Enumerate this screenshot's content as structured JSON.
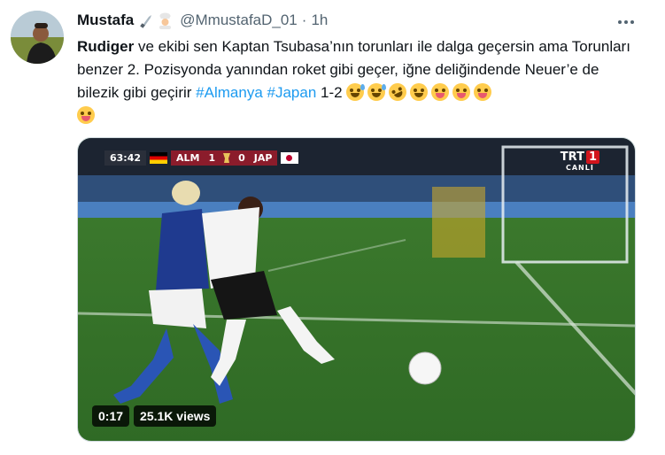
{
  "user": {
    "display_name": "Mustafa",
    "name_emoji": [
      "knife-icon",
      "cook-icon"
    ],
    "handle": "@MmustafaD_01",
    "separator": "·",
    "time": "1h"
  },
  "tweet": {
    "bold_lead": "Rudiger",
    "text_1": " ve ekibi sen Kaptan Tsubasa’nın torunları ile dalga geçersin ama Torunları benzer 2. Pozisyonda yanından roket gibi geçer, iğne deliğindende Neuer’e de bilezik gibi geçirir  ",
    "hashtag_1": "#Almanya",
    "hashtag_2": "#Japan",
    "text_2": "  1-2 ",
    "emojis": [
      "grinning-sweat-icon",
      "grinning-sweat-icon",
      "rofl-icon",
      "joy-icon",
      "zany-face-icon",
      "winking-tongue-icon",
      "winking-tongue-icon",
      "zany-face-icon"
    ]
  },
  "video": {
    "score_time": "63:42",
    "home": "ALM",
    "home_score": "1",
    "away_score": "0",
    "away": "JAP",
    "channel": "TRT",
    "channel_num": "1",
    "channel_sub": "CANLI",
    "duration": "0:17",
    "views": "25.1K views"
  },
  "colors": {
    "link": "#1d9bf0",
    "text": "#0f1419",
    "muted": "#536471"
  }
}
